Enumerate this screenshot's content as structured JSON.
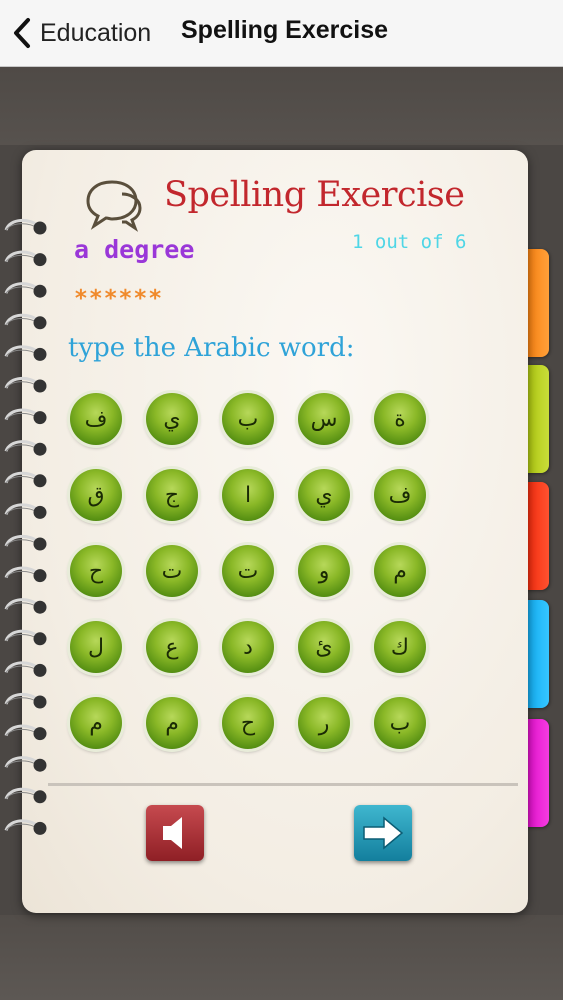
{
  "navbar": {
    "back_label": "Education",
    "title": "Spelling Exercise"
  },
  "header": {
    "title": "Spelling Exercise",
    "icon": "speech-bubbles-icon"
  },
  "exercise": {
    "word": "a degree",
    "progress": "1 out of 6",
    "stars": "******",
    "prompt": "type the Arabic word:"
  },
  "letters": [
    "ف",
    "ي",
    "ب",
    "س",
    "ة",
    "ق",
    "ج",
    "ا",
    "ي",
    "ف",
    "ح",
    "ت",
    "ت",
    "و",
    "م",
    "ل",
    "ع",
    "د",
    "ئ",
    "ك",
    "م",
    "م",
    "ح",
    "ر",
    "ب"
  ],
  "controls": {
    "speaker_icon": "speaker-icon",
    "next_icon": "arrow-right-icon"
  },
  "colors": {
    "title": "#c2272d",
    "word": "#9a37d8",
    "progress": "#4fd6e6",
    "stars": "#f08a2c",
    "prompt": "#2fa3d8",
    "tabs": [
      "#f97b07",
      "#a9c406",
      "#f52406",
      "#0aa8f0",
      "#e005c9"
    ]
  }
}
